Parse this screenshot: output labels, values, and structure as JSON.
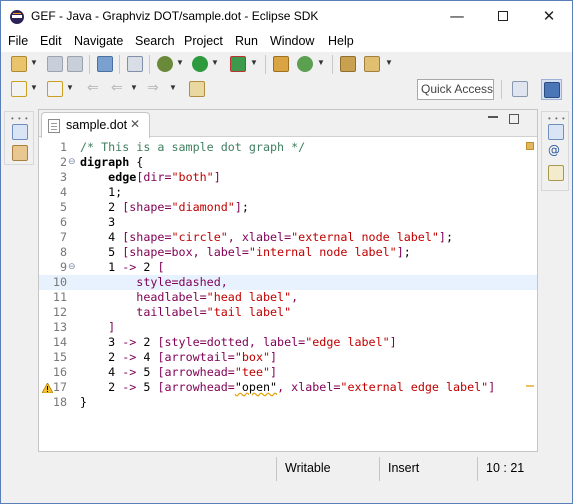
{
  "window": {
    "title": "GEF - Java - Graphviz DOT/sample.dot - Eclipse SDK",
    "minimize": "—",
    "close": "✕"
  },
  "menu": [
    "File",
    "Edit",
    "Navigate",
    "Search",
    "Project",
    "Run",
    "Window",
    "Help"
  ],
  "toolbar": {
    "quick_access": "Quick Access",
    "icons": [
      "new-wizard-icon",
      "save-icon",
      "save-all-icon",
      "tasks-icon",
      "debug-icon",
      "run-icon",
      "external-tools-icon",
      "new-java-project-icon",
      "open-type-icon",
      "search-icon",
      "next-annotation-icon",
      "prev-annotation-icon",
      "back-icon",
      "forward-icon",
      "pin-editor-icon",
      "open-perspective-icon",
      "java-perspective-icon"
    ]
  },
  "editor": {
    "tab_label": "sample.dot",
    "tab_close": "✕",
    "lines": [
      {
        "num": "1",
        "parts": [
          [
            "comment",
            "/* This is a sample dot graph */"
          ]
        ]
      },
      {
        "num": "2",
        "fold": "⊖",
        "parts": [
          [
            "kw",
            "digraph"
          ],
          [
            "num",
            " {"
          ]
        ]
      },
      {
        "num": "3",
        "parts": [
          [
            "num",
            "    "
          ],
          [
            "kw",
            "edge"
          ],
          [
            "attr",
            "[dir="
          ],
          [
            "str",
            "\"both\""
          ],
          [
            "attr",
            "]"
          ]
        ]
      },
      {
        "num": "4",
        "parts": [
          [
            "num",
            "    1;"
          ]
        ]
      },
      {
        "num": "5",
        "parts": [
          [
            "num",
            "    2 "
          ],
          [
            "attr",
            "[shape="
          ],
          [
            "str",
            "\"diamond\""
          ],
          [
            "attr",
            "]"
          ],
          [
            "num",
            ";"
          ]
        ]
      },
      {
        "num": "6",
        "parts": [
          [
            "num",
            "    3"
          ]
        ]
      },
      {
        "num": "7",
        "parts": [
          [
            "num",
            "    4 "
          ],
          [
            "attr",
            "[shape="
          ],
          [
            "str",
            "\"circle\""
          ],
          [
            "attr",
            ", xlabel="
          ],
          [
            "str",
            "\"external node label\""
          ],
          [
            "attr",
            "]"
          ],
          [
            "num",
            ";"
          ]
        ]
      },
      {
        "num": "8",
        "parts": [
          [
            "num",
            "    5 "
          ],
          [
            "attr",
            "[shape=box, label="
          ],
          [
            "str",
            "\"internal node label\""
          ],
          [
            "attr",
            "]"
          ],
          [
            "num",
            ";"
          ]
        ]
      },
      {
        "num": "9",
        "fold": "⊖",
        "parts": [
          [
            "num",
            "    1 "
          ],
          [
            "attr",
            "->"
          ],
          [
            "num",
            " 2 "
          ],
          [
            "attr",
            "["
          ]
        ]
      },
      {
        "num": "10",
        "current": true,
        "parts": [
          [
            "attr",
            "        style=dashed,"
          ]
        ]
      },
      {
        "num": "11",
        "parts": [
          [
            "attr",
            "        headlabel="
          ],
          [
            "str",
            "\"head label\""
          ],
          [
            "attr",
            ","
          ]
        ]
      },
      {
        "num": "12",
        "parts": [
          [
            "attr",
            "        taillabel="
          ],
          [
            "str",
            "\"tail label\""
          ]
        ]
      },
      {
        "num": "13",
        "parts": [
          [
            "attr",
            "    ]"
          ]
        ]
      },
      {
        "num": "14",
        "parts": [
          [
            "num",
            "    3 "
          ],
          [
            "attr",
            "->"
          ],
          [
            "num",
            " 2 "
          ],
          [
            "attr",
            "[style=dotted, label="
          ],
          [
            "str",
            "\"edge label\""
          ],
          [
            "attr",
            "]"
          ]
        ]
      },
      {
        "num": "15",
        "parts": [
          [
            "num",
            "    2 "
          ],
          [
            "attr",
            "->"
          ],
          [
            "num",
            " 4 "
          ],
          [
            "attr",
            "[arrowtail="
          ],
          [
            "str",
            "\"box\""
          ],
          [
            "attr",
            "]"
          ]
        ]
      },
      {
        "num": "16",
        "parts": [
          [
            "num",
            "    4 "
          ],
          [
            "attr",
            "->"
          ],
          [
            "num",
            " 5 "
          ],
          [
            "attr",
            "[arrowhead="
          ],
          [
            "str",
            "\"tee\""
          ],
          [
            "attr",
            "]"
          ]
        ]
      },
      {
        "num": "17",
        "warning": true,
        "parts": [
          [
            "num",
            "    2 "
          ],
          [
            "attr",
            "->"
          ],
          [
            "num",
            " 5 "
          ],
          [
            "attr",
            "[arrowhead="
          ],
          [
            "sq",
            "\"open\""
          ],
          [
            "attr",
            ", xlabel="
          ],
          [
            "str",
            "\"external edge label\""
          ],
          [
            "attr",
            "]"
          ]
        ]
      },
      {
        "num": "18",
        "parts": [
          [
            "num",
            "}"
          ]
        ]
      }
    ]
  },
  "status": {
    "writable": "Writable",
    "insert_mode": "Insert",
    "position": "10 : 21"
  },
  "colors": {
    "keyword": "#000000",
    "string": "#c00000",
    "attribute": "#7f0055",
    "comment": "#3f7f5f",
    "current_line": "#e8f2fe"
  }
}
